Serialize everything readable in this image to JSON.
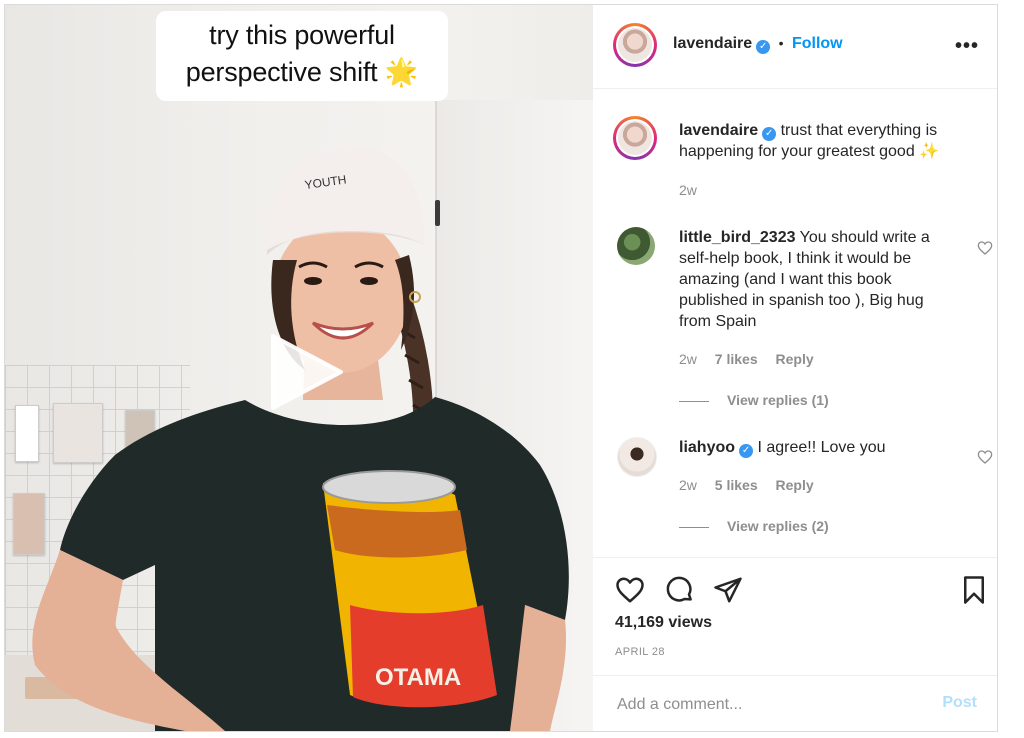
{
  "video": {
    "caption_line1": "try this powerful",
    "caption_line2": "perspective shift",
    "caption_emoji": "🌟",
    "cap_text": "YOUTH",
    "shirt_text": "OTAMA"
  },
  "header": {
    "username": "lavendaire",
    "separator": "•",
    "follow_label": "Follow",
    "more_label": "•••"
  },
  "post_caption": {
    "username": "lavendaire",
    "text": "trust that everything is happening for your greatest good",
    "emoji": "✨",
    "time": "2w"
  },
  "comments": [
    {
      "username": "little_bird_2323",
      "text": "You should write a self-help book, I think it would be amazing (and I want this book published in spanish too ), Big hug from Spain",
      "time": "2w",
      "likes": "7 likes",
      "reply_label": "Reply",
      "view_replies": "View replies (1)"
    },
    {
      "username": "liahyoo",
      "text": "I agree!! Love you",
      "time": "2w",
      "likes": "5 likes",
      "reply_label": "Reply",
      "view_replies": "View replies (2)"
    }
  ],
  "stats": {
    "views": "41,169 views",
    "date": "APRIL 28"
  },
  "comment_box": {
    "placeholder": "Add a comment...",
    "post_label": "Post"
  },
  "colors": {
    "link_blue": "#0095f6",
    "verified_blue": "#3897f0",
    "post_disabled": "#b2dffc",
    "muted": "#8e8e8e"
  },
  "icons": {
    "like": "heart-outline-icon",
    "comment": "comment-bubble-icon",
    "share": "paper-plane-icon",
    "save": "bookmark-icon",
    "play": "play-icon",
    "more": "more-options-icon"
  }
}
